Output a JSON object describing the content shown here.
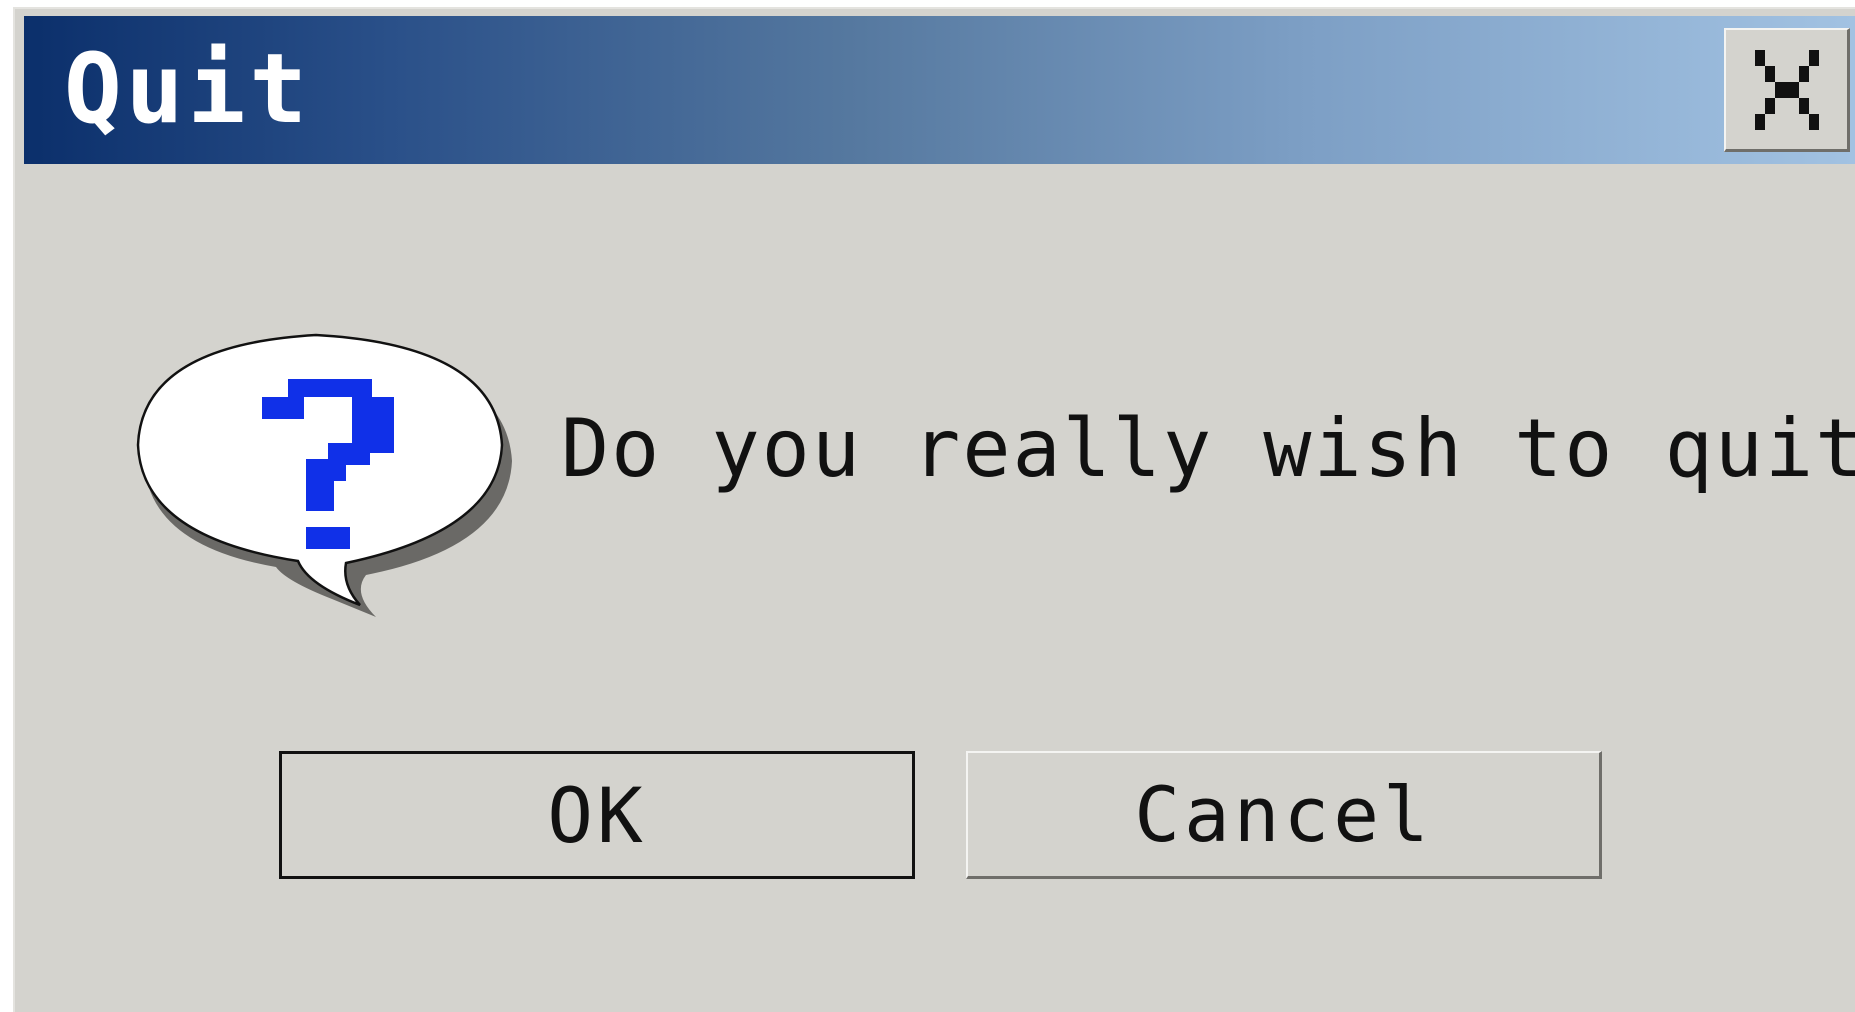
{
  "dialog": {
    "title": "Quit",
    "close_label": "X",
    "icon": "question-bubble-icon",
    "message": "Do you really wish to quit?",
    "ok_label": "OK",
    "cancel_label": "Cancel"
  },
  "colors": {
    "title_gradient_start": "#0b2f6b",
    "title_gradient_end": "#a2c2e2",
    "dialog_background": "#d4d3ce",
    "question_mark": "#1030e8"
  }
}
